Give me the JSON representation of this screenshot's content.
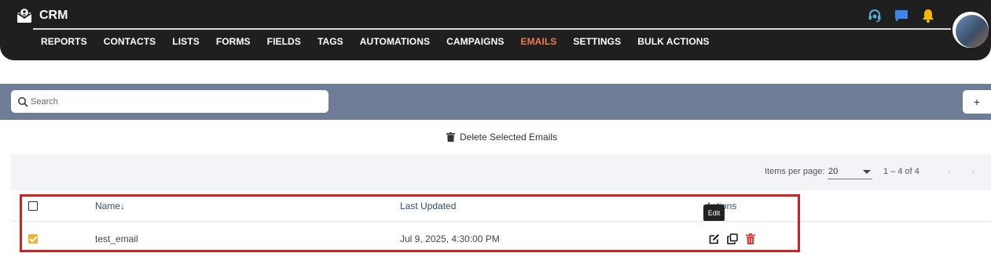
{
  "app": {
    "name": "CRM"
  },
  "nav": {
    "items": [
      "REPORTS",
      "CONTACTS",
      "LISTS",
      "FORMS",
      "FIELDS",
      "TAGS",
      "AUTOMATIONS",
      "CAMPAIGNS",
      "EMAILS",
      "SETTINGS",
      "BULK ACTIONS"
    ],
    "active": "EMAILS",
    "icons": [
      "headset-icon",
      "chat-icon",
      "bell-icon"
    ]
  },
  "search": {
    "placeholder": "Search",
    "value": ""
  },
  "toolbar": {
    "add_label": "+",
    "delete_selected_label": "Delete Selected Emails"
  },
  "paginator": {
    "items_per_page_label": "Items per page:",
    "items_per_page_value": "20",
    "range_label": "1 – 4 of 4"
  },
  "table": {
    "headers": {
      "name": "Name",
      "last_updated": "Last Updated",
      "actions": "Actions"
    },
    "sort_indicator": "↓",
    "rows": [
      {
        "checked": true,
        "name": "test_email",
        "last_updated": "Jul 9, 2025, 4:30:00 PM"
      }
    ]
  },
  "tooltip": {
    "text": "Edit"
  },
  "colors": {
    "nav_bg": "#1f1f1f",
    "active": "#ee7a52",
    "band": "#6e7d95",
    "header_text": "#2f4f76",
    "checkbox_checked": "#f0b33a",
    "delete_icon": "#e53935",
    "highlight": "#d81e1e"
  }
}
